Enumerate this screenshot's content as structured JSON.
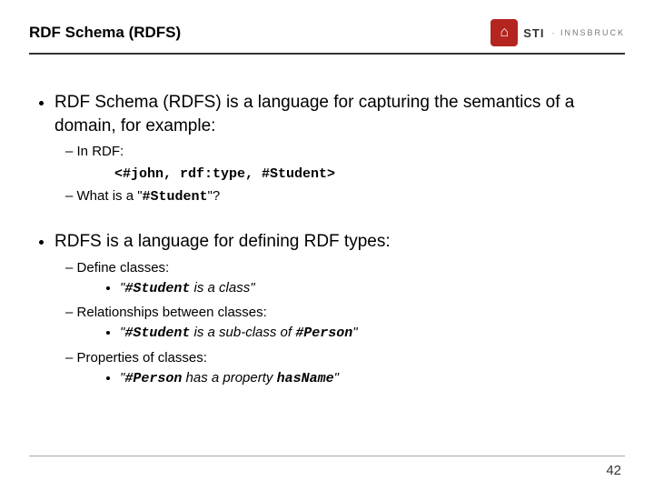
{
  "header": {
    "title": "RDF Schema (RDFS)",
    "logo": {
      "mark": "⌂",
      "main": "STI",
      "sub": "· INNSBRUCK"
    }
  },
  "bullets": {
    "b1_1": "RDF Schema (RDFS) is a language for capturing the semantics of a domain, for example:",
    "b1_1_sub1": "In RDF:",
    "b1_1_code": "<#john, rdf:type, #Student>",
    "b1_1_sub2_pre": "What is a \"",
    "b1_1_sub2_code": "#Student",
    "b1_1_sub2_post": "\"?",
    "b1_2": "RDFS is a language for defining RDF types:",
    "b1_2_s1": "Define classes:",
    "b1_2_s1_b_q1": "\"",
    "b1_2_s1_b_code": "#Student",
    "b1_2_s1_b_txt": " is a class\"",
    "b1_2_s2": "Relationships between classes:",
    "b1_2_s2_b_q1": "\"",
    "b1_2_s2_b_code1": "#Student",
    "b1_2_s2_b_txt": " is a sub-class of ",
    "b1_2_s2_b_code2": "#Person",
    "b1_2_s2_b_q2": "\"",
    "b1_2_s3": "Properties of classes:",
    "b1_2_s3_b_q1": "\"",
    "b1_2_s3_b_code1": "#Person",
    "b1_2_s3_b_txt": " has a property ",
    "b1_2_s3_b_code2": "hasName",
    "b1_2_s3_b_q2": "\""
  },
  "footer": {
    "page": "42"
  }
}
